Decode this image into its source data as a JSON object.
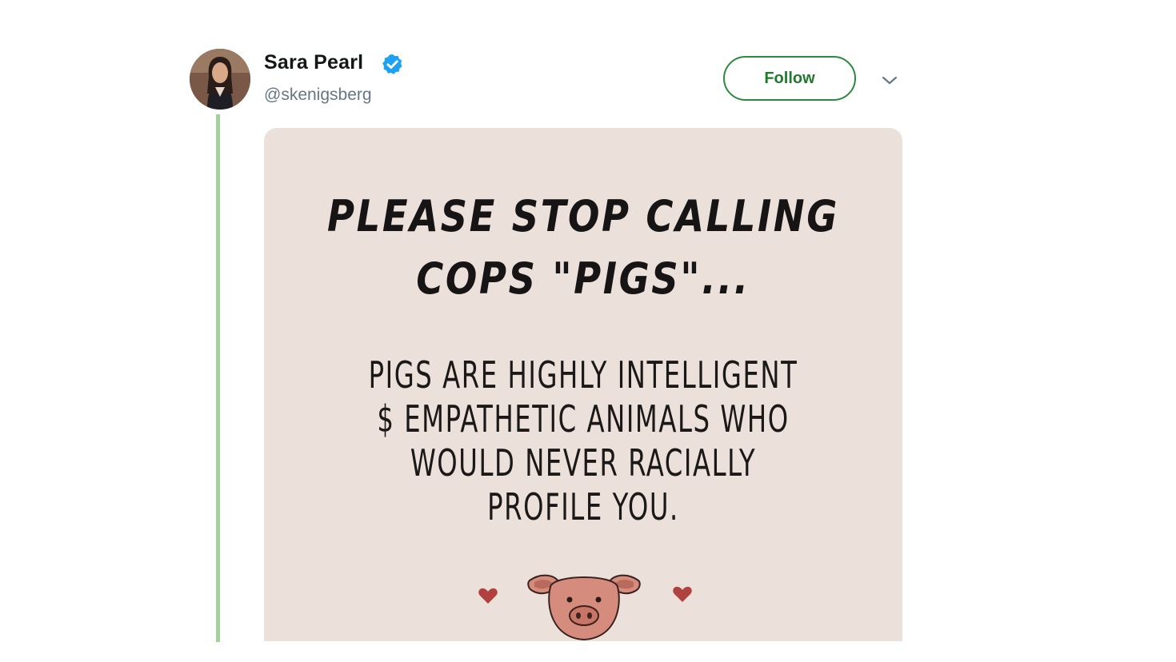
{
  "tweet": {
    "author": {
      "display_name": "Sara Pearl",
      "handle": "@skenigsberg",
      "verified": true,
      "avatar_icon": "avatar-photo"
    },
    "actions": {
      "follow_label": "Follow",
      "menu_icon": "chevron-down-icon"
    },
    "media": {
      "headline_lines": [
        "PLEASE STOP CALLING",
        "COPS \"PIGS\"..."
      ],
      "body_lines": [
        "PIGS ARE HIGHLY INTELLIGENT",
        "$ EMPATHETIC ANIMALS WHO",
        "WOULD NEVER RACIALLY",
        "PROFILE YOU."
      ],
      "illustration_icon": "pig-face-icon",
      "decoration_icon": "heart-icon"
    }
  },
  "colors": {
    "accent_green": "#2b8a3e",
    "thread_line": "#a6cf9e",
    "verified_blue": "#1da1f2",
    "card_background": "#ece0db",
    "handle_gray": "#657786",
    "heart_red": "#b0413e",
    "pig_pink": "#d68c7c"
  }
}
